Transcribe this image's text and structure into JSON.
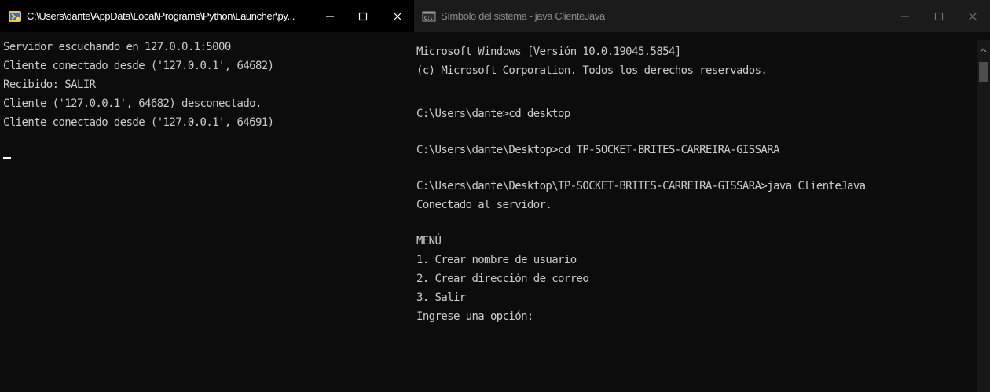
{
  "left_window": {
    "title": "C:\\Users\\dante\\AppData\\Local\\Programs\\Python\\Launcher\\py...",
    "icon": "python-launcher-icon",
    "controls": {
      "minimize": "minimize-icon",
      "maximize": "maximize-icon",
      "close": "close-icon"
    },
    "lines": [
      "Servidor escuchando en 127.0.0.1:5000",
      "Cliente conectado desde ('127.0.0.1', 64682)",
      "Recibido: SALIR",
      "Cliente ('127.0.0.1', 64682) desconectado.",
      "Cliente conectado desde ('127.0.0.1', 64691)"
    ]
  },
  "right_window": {
    "title": "Símbolo del sistema - java  ClienteJava",
    "icon": "cmd-icon",
    "controls": {
      "minimize": "minimize-icon",
      "maximize": "maximize-icon",
      "close": "close-icon"
    },
    "lines": [
      "Microsoft Windows [Versión 10.0.19045.5854]",
      "(c) Microsoft Corporation. Todos los derechos reservados.",
      "",
      "C:\\Users\\dante>cd desktop",
      "",
      "C:\\Users\\dante\\Desktop>cd TP-SOCKET-BRITES-CARREIRA-GISSARA",
      "",
      "C:\\Users\\dante\\Desktop\\TP-SOCKET-BRITES-CARREIRA-GISSARA>java ClienteJava",
      "Conectado al servidor.",
      "",
      "MENÚ",
      "1. Crear nombre de usuario",
      "2. Crear dirección de correo",
      "3. Salir",
      "Ingrese una opción:"
    ]
  },
  "colors": {
    "console_bg": "#0c0c0c",
    "console_text": "#cccccc",
    "active_titlebar": "#000000",
    "inactive_titlebar": "#1b1b1b"
  }
}
